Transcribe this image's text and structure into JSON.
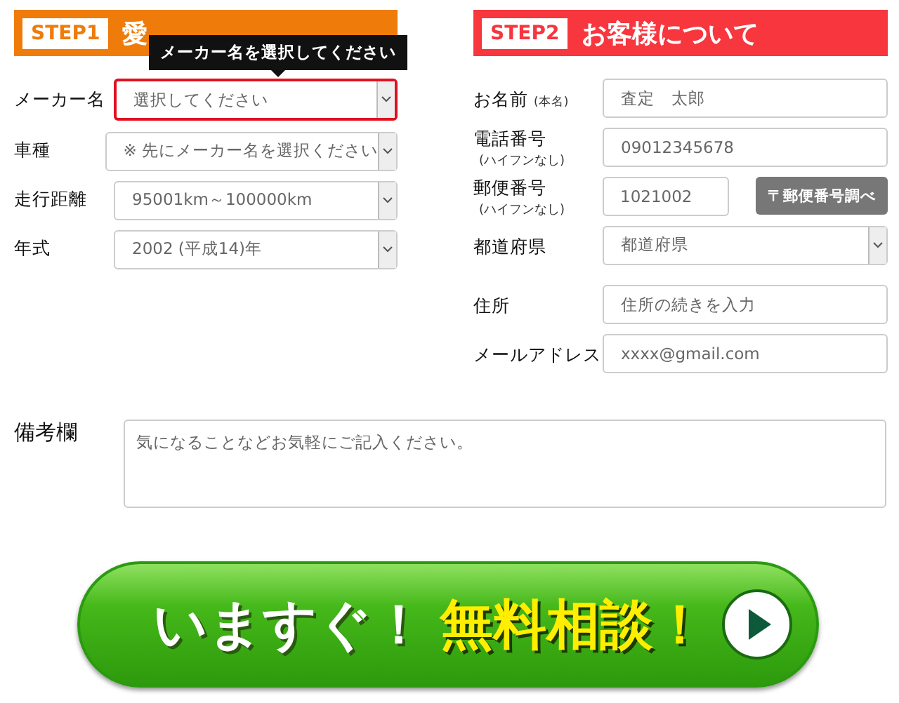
{
  "step1": {
    "badge": "STEP1",
    "title": "愛",
    "tooltip": "メーカー名を選択してください",
    "fields": [
      {
        "label": "メーカー名",
        "kind": "select",
        "value": "選択してください",
        "error": true
      },
      {
        "label": "車種",
        "kind": "select",
        "value": "※ 先にメーカー名を選択ください",
        "error": false
      },
      {
        "label": "走行距離",
        "kind": "select",
        "value": "95001km～100000km",
        "error": false
      },
      {
        "label": "年式",
        "kind": "select",
        "value": "2002 (平成14)年",
        "error": false
      }
    ]
  },
  "step2": {
    "badge": "STEP2",
    "title": "お客様について",
    "fields": [
      {
        "label": "お名前",
        "note": "(本名)",
        "kind": "input",
        "placeholder": "査定　太郎"
      },
      {
        "label": "電話番号",
        "sub": "(ハイフンなし)",
        "kind": "input",
        "placeholder": "09012345678"
      },
      {
        "label": "郵便番号",
        "sub": "(ハイフンなし)",
        "kind": "postal",
        "placeholder": "1021002",
        "button": "〒郵便番号調べ"
      },
      {
        "label": "都道府県",
        "kind": "select",
        "value": "都道府県"
      },
      {
        "label": "住所",
        "kind": "input",
        "placeholder": "住所の続きを入力"
      },
      {
        "label": "メールアドレス",
        "kind": "input",
        "placeholder": "xxxx@gmail.com"
      }
    ]
  },
  "remarks": {
    "label": "備考欄",
    "placeholder": "気になることなどお気軽にご記入ください。"
  },
  "cta": {
    "lead": "いますぐ！",
    "main": "無料相談！"
  }
}
